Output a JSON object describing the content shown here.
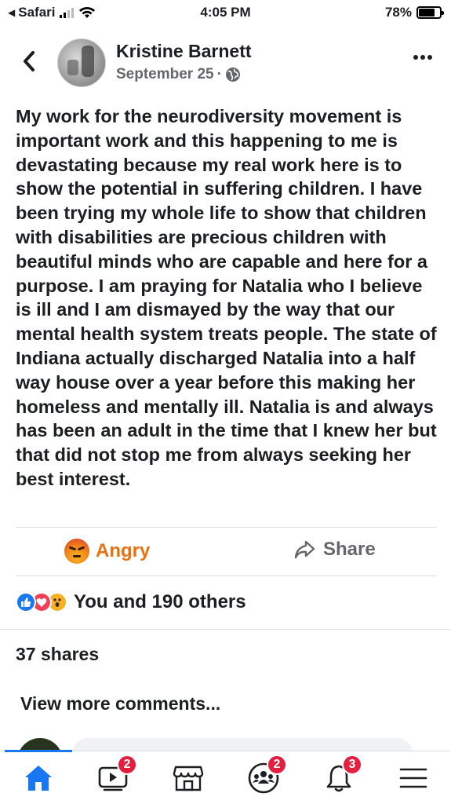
{
  "status_bar": {
    "carrier": "Safari",
    "time": "4:05 PM",
    "battery_percent": "78%",
    "battery_level": 0.78
  },
  "post": {
    "author": "Kristine Barnett",
    "date": "September 25",
    "separator": "·",
    "privacy_icon": "globe-icon",
    "text": "My work for the neurodiversity movement  is important work and this happening to me is devastating because my real work here is to show the potential in suffering children. I have been trying my whole life to show that children with disabilities are precious children with beautiful minds who are capable and here for a purpose. I am praying for Natalia who I believe is ill and I am dismayed by the way that our mental health system treats people. The state of Indiana actually discharged Natalia into a half way house over a year before this making her homeless and mentally ill. Natalia is and always has been an adult in the time that I knew her but that did not stop me from always seeking her best interest."
  },
  "actions": {
    "reaction_label": "Angry",
    "share_label": "Share"
  },
  "reactions": {
    "icons": [
      "like-icon",
      "love-icon",
      "wow-icon"
    ],
    "summary": "You and 190 others"
  },
  "shares": "37 shares",
  "comments": {
    "view_more": "View more comments..."
  },
  "tab_bar": {
    "tabs": [
      {
        "name": "home",
        "icon": "home-icon",
        "badge": ""
      },
      {
        "name": "watch",
        "icon": "video-icon",
        "badge": "2"
      },
      {
        "name": "marketplace",
        "icon": "shop-icon",
        "badge": ""
      },
      {
        "name": "groups",
        "icon": "groups-icon",
        "badge": "2"
      },
      {
        "name": "notifications",
        "icon": "bell-icon",
        "badge": "3"
      },
      {
        "name": "menu",
        "icon": "menu-icon",
        "badge": ""
      }
    ]
  },
  "colors": {
    "accent": "#1877f2",
    "angry": "#e9710f",
    "badge": "#e41e3f",
    "muted_text": "#65676b"
  }
}
